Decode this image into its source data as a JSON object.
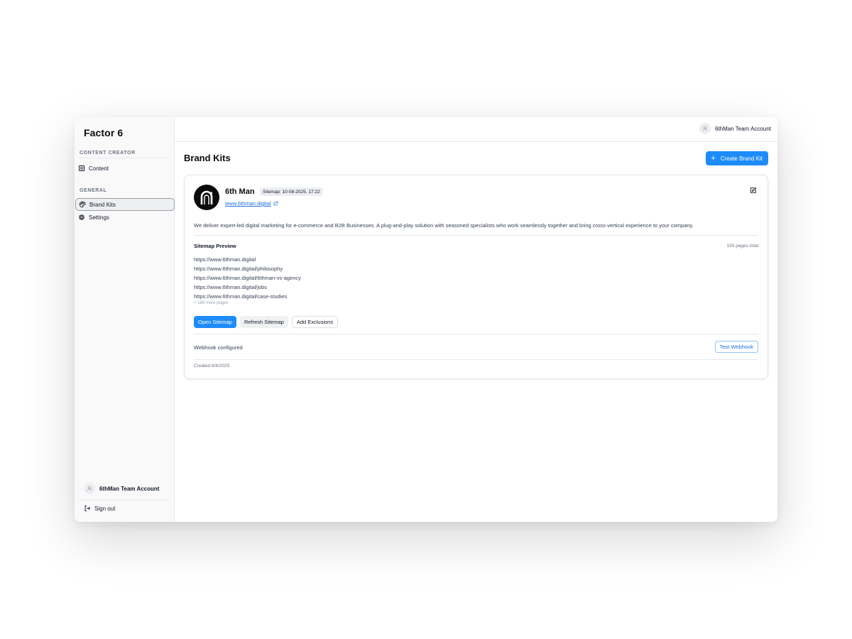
{
  "app": {
    "title": "Factor 6"
  },
  "sidebar": {
    "sections": [
      {
        "label": "CONTENT CREATOR",
        "items": [
          {
            "label": "Content",
            "icon": "document-icon"
          }
        ]
      },
      {
        "label": "GENERAL",
        "items": [
          {
            "label": "Brand Kits",
            "icon": "palette-icon",
            "active": true
          },
          {
            "label": "Settings",
            "icon": "gear-icon"
          }
        ]
      }
    ],
    "account_name": "6thMan Team Account",
    "signout_label": "Sign out"
  },
  "topbar": {
    "account_name": "6thMan Team Account"
  },
  "page": {
    "title": "Brand Kits",
    "create_button_label": "Create Brand Kit"
  },
  "brand_kit": {
    "name": "6th Man",
    "sitemap_badge": "Sitemap: 10-08-2025, 17:22",
    "website": "www.6thman.digital",
    "description": "We deliver expert-led digital marketing for e-commerce and B2B Businesses. A plug-and-play solution with seasoned specialists who work seamlessly together and bring cross-vertical experience to your company.",
    "sitemap_preview_title": "Sitemap Preview",
    "pages_total": "193 pages total",
    "sitemap_urls": [
      "https://www.6thman.digital",
      "https://www.6thman.digital/philosophy",
      "https://www.6thman.digital/6thman-vs-agency",
      "https://www.6thman.digital/jobs",
      "https://www.6thman.digital/case-studies"
    ],
    "more_pages": "+ 188 more pages",
    "buttons": {
      "open_sitemap": "Open Sitemap",
      "refresh_sitemap": "Refresh Sitemap",
      "add_exclusions": "Add Exclusions"
    },
    "webhook_status": "Webhook configured",
    "test_webhook_label": "Test Webhook",
    "created": "Created 8/8/2025"
  },
  "colors": {
    "accent": "#1d8cf8",
    "link": "#1d6fe0",
    "sidebar_bg": "#f9f9fa"
  }
}
